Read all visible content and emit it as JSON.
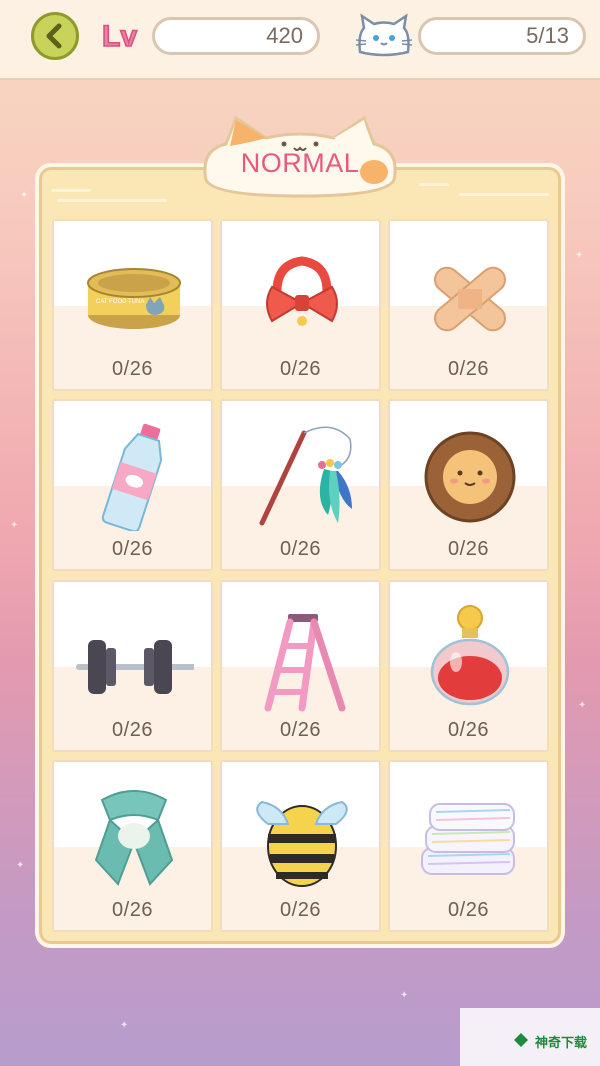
{
  "header": {
    "level_badge": "Lv",
    "level_value": "420",
    "cat_count": "5/13"
  },
  "panel": {
    "title": "NORMAL"
  },
  "items": [
    {
      "name": "cat-food-can",
      "count": "0/26",
      "label_text": "CAT FOOD TUNA"
    },
    {
      "name": "red-bow-collar",
      "count": "0/26"
    },
    {
      "name": "bandage",
      "count": "0/26"
    },
    {
      "name": "water-bottle",
      "count": "0/26"
    },
    {
      "name": "feather-toy",
      "count": "0/26"
    },
    {
      "name": "lion-mane",
      "count": "0/26"
    },
    {
      "name": "dumbbell",
      "count": "0/26"
    },
    {
      "name": "ladder",
      "count": "0/26"
    },
    {
      "name": "perfume-bottle",
      "count": "0/26"
    },
    {
      "name": "scarf",
      "count": "0/26"
    },
    {
      "name": "bee-costume",
      "count": "0/26"
    },
    {
      "name": "towels",
      "count": "0/26"
    }
  ],
  "watermark": {
    "text": "神奇下载"
  },
  "colors": {
    "title": "#e85a84",
    "panel_bg": "#fbe6b5",
    "back_button": "#c8d35a"
  }
}
